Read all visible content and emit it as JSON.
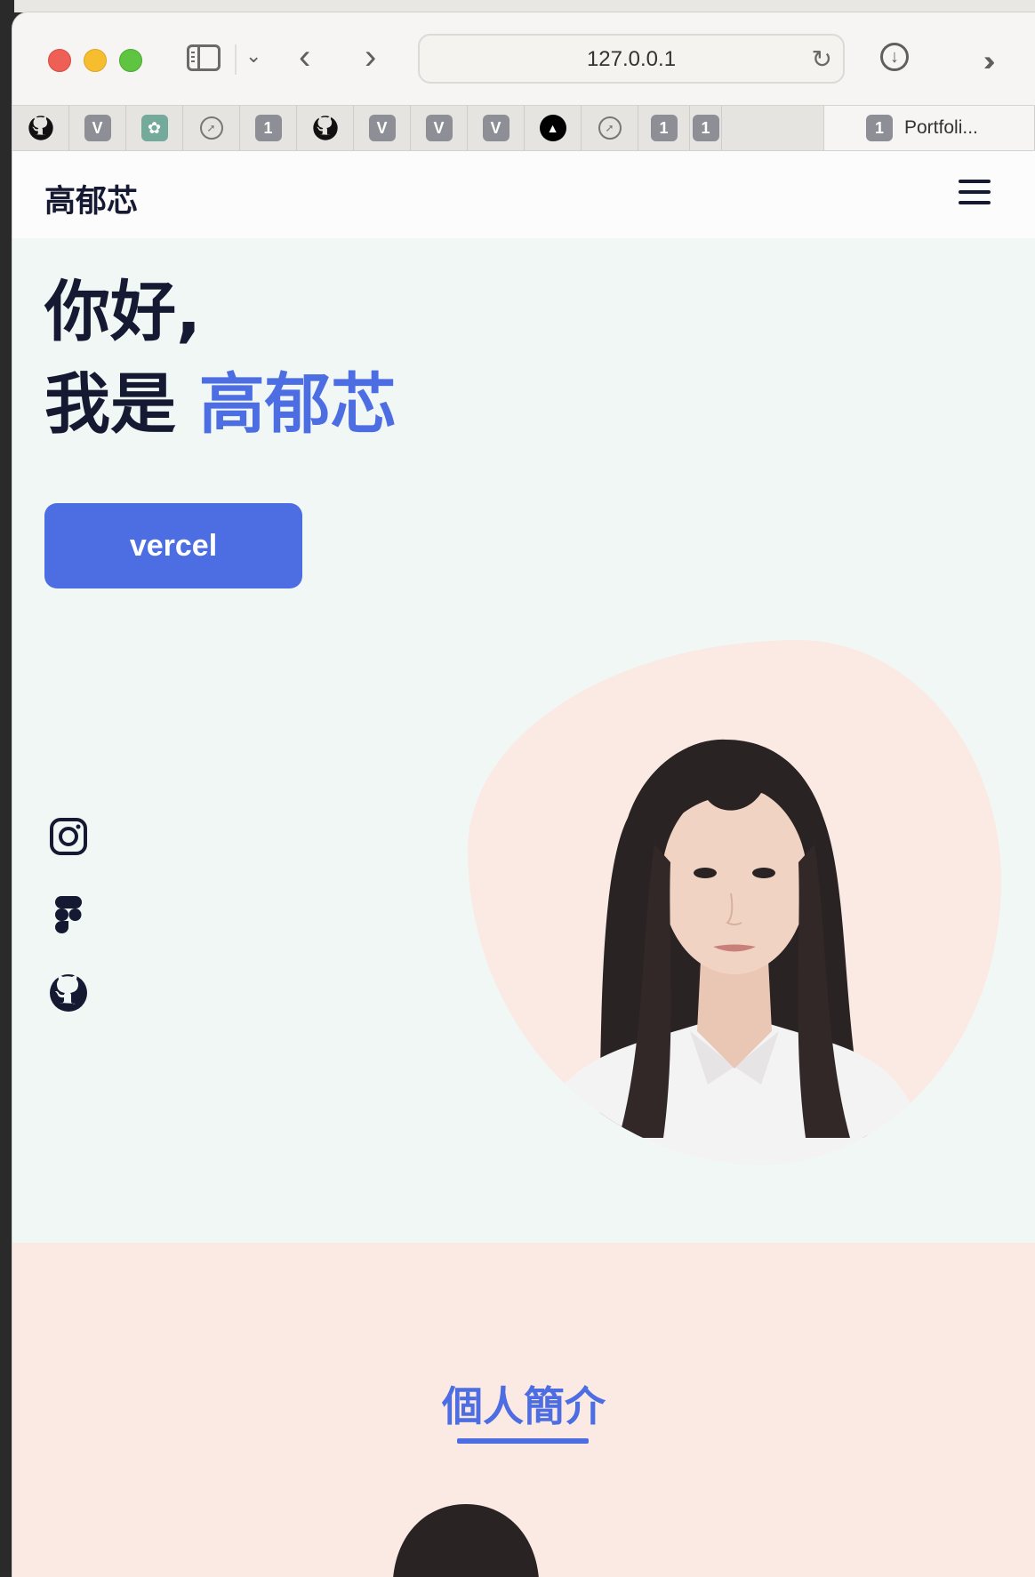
{
  "browser": {
    "url": "127.0.0.1",
    "tabs": [
      {
        "icon": "github-icon",
        "label": ""
      },
      {
        "icon": "v-icon",
        "label": "V"
      },
      {
        "icon": "chatgpt-icon",
        "label": ""
      },
      {
        "icon": "compass-icon",
        "label": ""
      },
      {
        "icon": "one-icon",
        "label": "1"
      },
      {
        "icon": "github-icon",
        "label": ""
      },
      {
        "icon": "v-icon",
        "label": "V"
      },
      {
        "icon": "v-icon",
        "label": "V"
      },
      {
        "icon": "v-icon",
        "label": "V"
      },
      {
        "icon": "vercel-icon",
        "label": ""
      },
      {
        "icon": "compass-icon",
        "label": ""
      },
      {
        "icon": "one-icon",
        "label": "1"
      },
      {
        "icon": "one-icon",
        "label": "1"
      }
    ],
    "active_tab": {
      "icon_label": "1",
      "title": "Portfoli..."
    }
  },
  "site": {
    "brand": "高郁芯",
    "hero": {
      "line1": "你好,",
      "line2_prefix": "我是 ",
      "name": "高郁芯",
      "cta_label": "vercel"
    },
    "social": [
      "instagram-icon",
      "figma-icon",
      "github-icon"
    ],
    "about_title": "個人簡介"
  },
  "colors": {
    "accent": "#4d6de3",
    "dark": "#151a32",
    "hero_bg": "#f1f7f5",
    "peach": "#fbeae3"
  }
}
